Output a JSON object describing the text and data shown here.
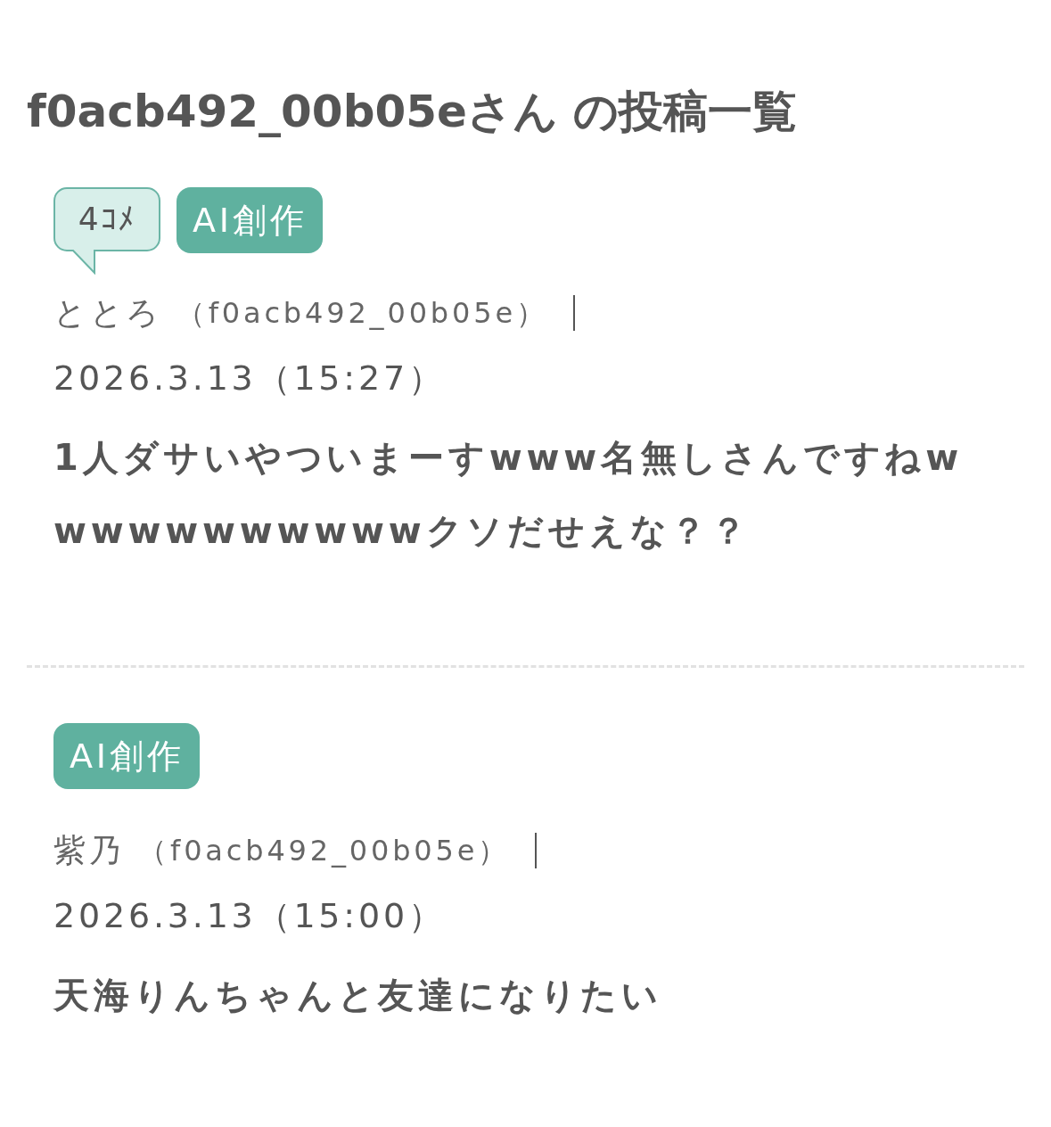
{
  "title": "f0acb492_00b05eさん の投稿一覧",
  "posts": [
    {
      "tags": [
        {
          "kind": "comment-bubble",
          "text": "4ｺﾒ"
        },
        {
          "kind": "label",
          "text": "AI創作"
        }
      ],
      "author": "ととろ",
      "user_id": "（f0acb492_00b05e）",
      "date": "2026.3.13（15:27）",
      "body": "1人ダサいやついまーすwww名無しさんですねwwwwwwwwwwwクソだせえな？？"
    },
    {
      "tags": [
        {
          "kind": "label",
          "text": "AI創作"
        }
      ],
      "author": "紫乃",
      "user_id": "（f0acb492_00b05e）",
      "date": "2026.3.13（15:00）",
      "body": "天海りんちゃんと友達になりたい"
    }
  ]
}
